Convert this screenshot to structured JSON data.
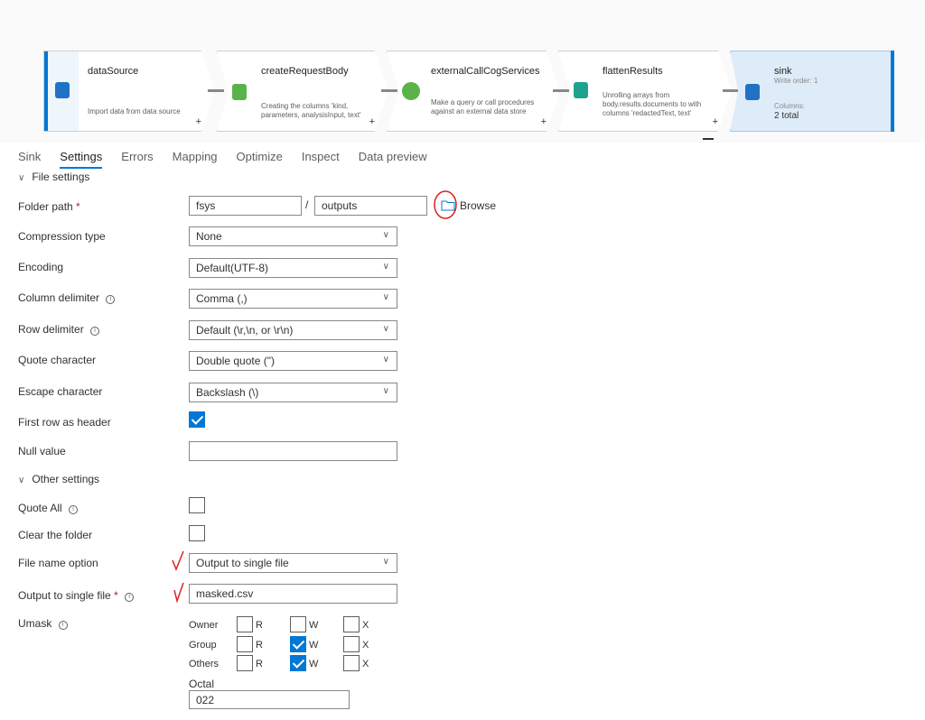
{
  "pipeline": {
    "nodes": [
      {
        "title": "dataSource",
        "desc": "Import data from data source",
        "icon": "source-icon"
      },
      {
        "title": "createRequestBody",
        "desc": "Creating the columns 'kind, parameters, analysisInput, text'",
        "icon": "derived-column-icon"
      },
      {
        "title": "externalCallCogServices",
        "desc": "Make a query or call procedures against an external data store",
        "icon": "external-call-icon"
      },
      {
        "title": "flattenResults",
        "desc": "Unrolling arrays from body.results.documents to with columns 'redactedText, text'",
        "icon": "flatten-icon"
      }
    ],
    "sink": {
      "title": "sink",
      "write_order_label": "Write order: 1",
      "columns_label": "Columns:",
      "columns_value": "2 total"
    },
    "plus": "+"
  },
  "tabs": [
    "Sink",
    "Settings",
    "Errors",
    "Mapping",
    "Optimize",
    "Inspect",
    "Data preview"
  ],
  "active_tab": "Settings",
  "file_settings": {
    "section_title": "File settings",
    "folder_path_label": "Folder path",
    "required_mark": "*",
    "folder_container": "fsys",
    "folder_separator": "/",
    "folder_dir": "outputs",
    "browse_label": "Browse",
    "compression_label": "Compression type",
    "compression_value": "None",
    "encoding_label": "Encoding",
    "encoding_value": "Default(UTF-8)",
    "column_delim_label": "Column delimiter",
    "column_delim_value": "Comma (,)",
    "row_delim_label": "Row delimiter",
    "row_delim_value": "Default (\\r,\\n, or \\r\\n)",
    "quote_char_label": "Quote character",
    "quote_char_value": "Double quote (\")",
    "escape_char_label": "Escape character",
    "escape_char_value": "Backslash (\\)",
    "first_row_label": "First row as header",
    "first_row_checked": true,
    "null_value_label": "Null value",
    "null_value": ""
  },
  "other_settings": {
    "section_title": "Other settings",
    "quote_all_label": "Quote All",
    "clear_folder_label": "Clear the folder",
    "file_name_option_label": "File name option",
    "file_name_option_value": "Output to single file",
    "output_single_label": "Output to single file",
    "output_single_value": "masked.csv",
    "umask_label": "Umask",
    "umask_rows": [
      {
        "name": "Owner",
        "r": false,
        "w": false,
        "x": false
      },
      {
        "name": "Group",
        "r": false,
        "w": true,
        "x": false
      },
      {
        "name": "Others",
        "r": false,
        "w": true,
        "x": false
      }
    ],
    "perm_letters": {
      "r": "R",
      "w": "W",
      "x": "X"
    },
    "octal_label": "Octal",
    "octal_value": "022"
  },
  "info_glyph": "i",
  "colors": {
    "accent": "#0078d4",
    "annotation": "#e02020"
  }
}
